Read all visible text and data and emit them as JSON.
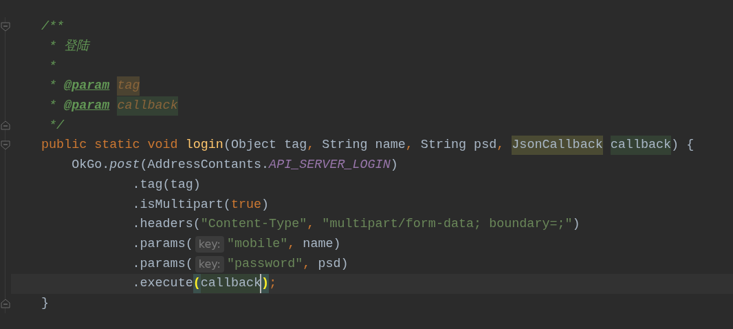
{
  "editor": {
    "lines": [
      {
        "fold": {
          "kind": "start"
        },
        "current": false,
        "tokens": [
          {
            "text": "/**",
            "kind": "doc"
          }
        ]
      },
      {
        "current": false,
        "tokens": [
          {
            "text": " * 登陆",
            "kind": "doc"
          }
        ]
      },
      {
        "current": false,
        "tokens": [
          {
            "text": " *",
            "kind": "doc"
          }
        ]
      },
      {
        "current": false,
        "tokens": [
          {
            "text": " * ",
            "kind": "doc"
          },
          {
            "text": "@param",
            "kind": "doctag"
          },
          {
            "text": " tag",
            "kind": "docparam",
            "color": "#4b4331"
          }
        ]
      },
      {
        "current": false,
        "tokens": [
          {
            "text": " * ",
            "kind": "doc"
          },
          {
            "text": "@param",
            "kind": "doctag"
          },
          {
            "text": " callback",
            "kind": "docparam",
            "color": "#344134"
          }
        ]
      },
      {
        "fold": {
          "kind": "end"
        },
        "current": false,
        "tokens": [
          {
            "text": " */",
            "kind": "doc"
          }
        ]
      },
      {
        "fold": {
          "kind": "start"
        },
        "current": false,
        "tokens": [
          {
            "text": "public static void ",
            "kind": "keyword"
          },
          {
            "text": "login",
            "kind": "method"
          },
          {
            "text": "(Object tag",
            "kind": "plain"
          },
          {
            "text": ",",
            "kind": "punct"
          },
          {
            "text": " String name",
            "kind": "plain"
          },
          {
            "text": ",",
            "kind": "punct"
          },
          {
            "text": " String psd",
            "kind": "plain"
          },
          {
            "text": ",",
            "kind": "punct"
          },
          {
            "text": " JsonCallback",
            "kind": "plain",
            "color": "#4a4a33"
          },
          {
            "text": " callback",
            "kind": "plain",
            "color": "#344134"
          },
          {
            "text": ") {",
            "kind": "plain"
          }
        ]
      },
      {
        "current": false,
        "tokens": [
          {
            "text": "    OkGo.",
            "kind": "plain"
          },
          {
            "text": "post",
            "kind": "static"
          },
          {
            "text": "(AddressContants.",
            "kind": "plain"
          },
          {
            "text": "API_SERVER_LOGIN",
            "kind": "constant"
          },
          {
            "text": ")",
            "kind": "plain"
          }
        ]
      },
      {
        "current": false,
        "tokens": [
          {
            "text": "            .tag(tag)",
            "kind": "plain"
          }
        ]
      },
      {
        "current": false,
        "tokens": [
          {
            "text": "            .isMultipart(",
            "kind": "plain"
          },
          {
            "text": "true",
            "kind": "keyword"
          },
          {
            "text": ")",
            "kind": "plain"
          }
        ]
      },
      {
        "current": false,
        "tokens": [
          {
            "text": "            .headers(",
            "kind": "plain"
          },
          {
            "text": "\"Content-Type\"",
            "kind": "string"
          },
          {
            "text": ",",
            "kind": "punct"
          },
          {
            "text": " \"multipart/form-data; boundary=;\"",
            "kind": "string"
          },
          {
            "text": ")",
            "kind": "plain"
          }
        ]
      },
      {
        "current": false,
        "tokens": [
          {
            "text": "            .params(",
            "kind": "plain"
          },
          {
            "text": "key:",
            "kind": "hint"
          },
          {
            "text": "\"mobile\"",
            "kind": "string"
          },
          {
            "text": ",",
            "kind": "punct"
          },
          {
            "text": " name)",
            "kind": "plain"
          }
        ]
      },
      {
        "current": false,
        "tokens": [
          {
            "text": "            .params(",
            "kind": "plain"
          },
          {
            "text": "key:",
            "kind": "hint"
          },
          {
            "text": "\"password\"",
            "kind": "string"
          },
          {
            "text": ",",
            "kind": "punct"
          },
          {
            "text": " psd)",
            "kind": "plain"
          }
        ]
      },
      {
        "current": true,
        "tokens": [
          {
            "text": "            .execute",
            "kind": "plain"
          },
          {
            "text": "(",
            "kind": "bracket",
            "color": "#3b514d"
          },
          {
            "text": "callback",
            "kind": "plain",
            "color": "#344134",
            "caret": true
          },
          {
            "text": ")",
            "kind": "bracket",
            "color": "#3b514d"
          },
          {
            "text": ";",
            "kind": "punct"
          }
        ]
      },
      {
        "fold": {
          "kind": "end"
        },
        "current": false,
        "tokens": [
          {
            "text": "}",
            "kind": "plain"
          }
        ]
      }
    ]
  }
}
